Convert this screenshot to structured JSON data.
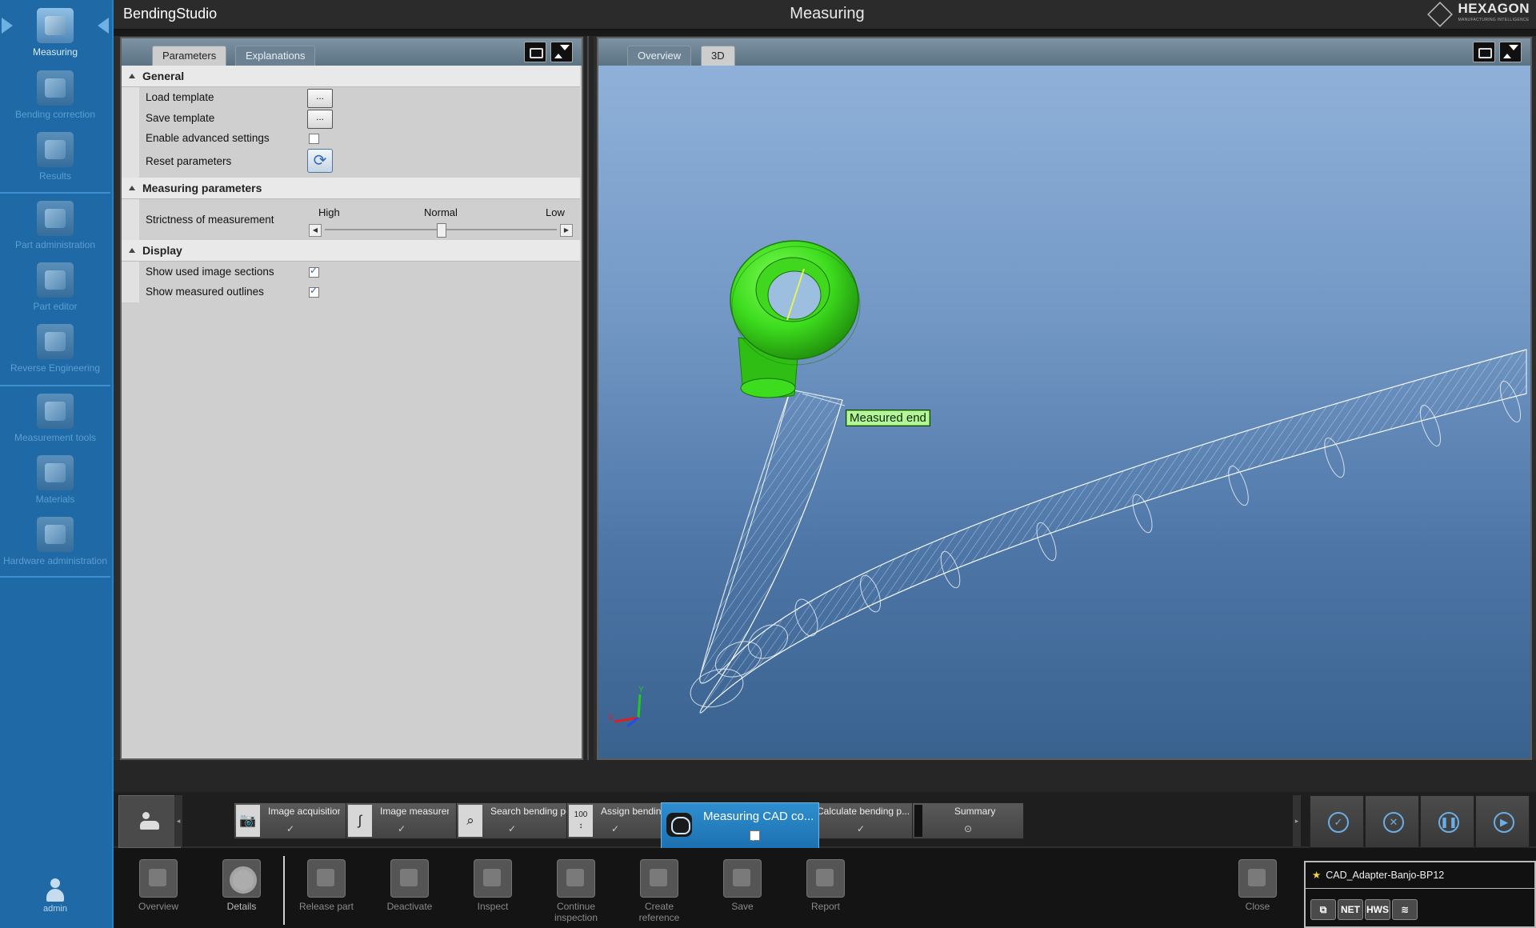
{
  "app": {
    "title_prefix": "Bending",
    "title_suffix": "Studio",
    "page_title": "Measuring",
    "logo_text": "HEXAGON",
    "logo_sub": "MANUFACTURING INTELLIGENCE"
  },
  "sidebar": {
    "items": [
      {
        "label": "Measuring",
        "icon": "measuring-icon",
        "active": true
      },
      {
        "label": "Bending correction",
        "icon": "bending-correction-icon"
      },
      {
        "label": "Results",
        "icon": "results-icon"
      },
      {
        "label": "Part administration",
        "icon": "part-administration-icon"
      },
      {
        "label": "Part editor",
        "icon": "part-editor-icon"
      },
      {
        "label": "Reverse Engineering",
        "icon": "reverse-engineering-icon"
      },
      {
        "label": "Measurement tools",
        "icon": "measurement-tools-icon"
      },
      {
        "label": "Materials",
        "icon": "materials-icon"
      },
      {
        "label": "Hardware administration",
        "icon": "hardware-administration-icon"
      }
    ],
    "user": "admin"
  },
  "left_panel": {
    "tabs": [
      "Parameters",
      "Explanations"
    ],
    "active_tab": "Parameters",
    "sections": {
      "general": {
        "title": "General",
        "load_template": "Load template",
        "save_template": "Save template",
        "enable_advanced": "Enable advanced settings",
        "enable_advanced_checked": false,
        "reset_parameters": "Reset parameters",
        "dots": "..."
      },
      "measuring": {
        "title": "Measuring parameters",
        "strictness_label": "Strictness of measurement",
        "high": "High",
        "normal": "Normal",
        "low": "Low",
        "strictness_value": 0.5
      },
      "display": {
        "title": "Display",
        "show_used_sections": "Show used image sections",
        "show_used_sections_checked": true,
        "show_outlines": "Show measured outlines",
        "show_outlines_checked": true
      }
    }
  },
  "view_panel": {
    "tabs": [
      "Overview",
      "3D"
    ],
    "active_tab": "3D",
    "measured_end_label": "Measured end",
    "axis_x": "X",
    "axis_y": "Y"
  },
  "workflow": {
    "steps": [
      {
        "label": "Image acquisition",
        "status": "✓",
        "icon": "camera-icon"
      },
      {
        "label": "Image measurement",
        "status": "✓",
        "icon": "tube-shape-icon"
      },
      {
        "label": "Search bending points",
        "status": "✓",
        "icon": "magnifier-icon"
      },
      {
        "label": "Assign bending",
        "status": "✓",
        "icon": "assign-100-icon"
      },
      {
        "label": "Calculate bending p...",
        "status": "✓",
        "icon": "calculate-icon"
      },
      {
        "label": "Summary",
        "status": "⊙",
        "icon": "summary-icon"
      }
    ],
    "active_step": {
      "label": "Measuring CAD co...",
      "status": "✓"
    },
    "assign_icon_text": "100",
    "right_buttons": [
      "confirm-icon",
      "cancel-icon",
      "pause-icon",
      "play-icon"
    ]
  },
  "toolbar": {
    "items": [
      {
        "label": "Overview",
        "bright": false
      },
      {
        "label": "Details",
        "bright": true
      },
      {
        "label": "Release part",
        "bright": false
      },
      {
        "label": "Deactivate",
        "bright": false
      },
      {
        "label": "Inspect",
        "bright": false
      },
      {
        "label": "Continue inspection",
        "bright": false
      },
      {
        "label": "Create reference",
        "bright": false
      },
      {
        "label": "Save",
        "bright": false
      },
      {
        "label": "Report",
        "bright": false
      },
      {
        "label": "Close",
        "bright": false
      }
    ]
  },
  "document": {
    "name": "CAD_Adapter-Banjo-BP12",
    "status_icons": [
      "network-icon",
      "NET",
      "HWS",
      "database-icon"
    ]
  },
  "colors": {
    "sidebar": "#1f6aa6",
    "accent": "#2f8ecf",
    "part_green": "#3ddc1e",
    "label_green": "#b4f59a"
  }
}
